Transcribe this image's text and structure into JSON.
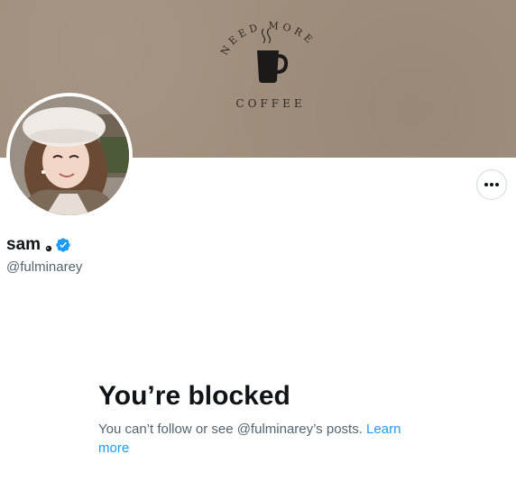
{
  "banner": {
    "arc_text": "NEED MORE",
    "bottom_text": "COFFEE",
    "background_color": "#a18f7e"
  },
  "profile": {
    "display_name": "sam",
    "name_emoji_icon": "small-face-icon",
    "verified_icon": "verified-badge-icon",
    "verified_color": "#1d9bf0",
    "handle": "@fulminarey"
  },
  "actions": {
    "more_icon": "more-horizontal-icon"
  },
  "blocked": {
    "title": "You’re blocked",
    "description": "You can’t follow or see @fulminarey’s posts.",
    "link_text": "Learn more",
    "link_color": "#1d9bf0"
  }
}
